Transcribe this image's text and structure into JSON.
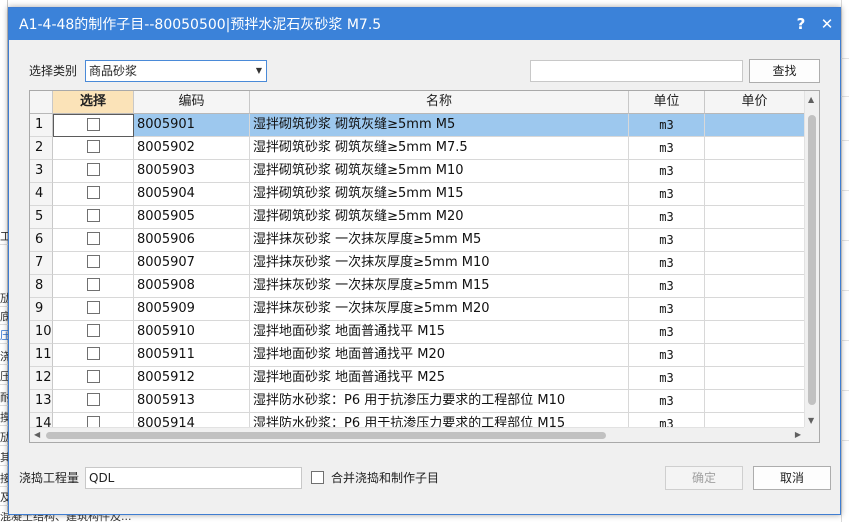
{
  "dialog": {
    "title": "A1-4-48的制作子目--80050500|预拌水泥石灰砂浆 M7.5",
    "help_glyph": "?",
    "close_glyph": "✕"
  },
  "filter": {
    "category_label": "选择类别",
    "category_value": "商品砂浆",
    "search_value": "",
    "search_button": "查找"
  },
  "table": {
    "columns": [
      "选择",
      "编码",
      "名称",
      "单位",
      "单价"
    ],
    "rows": [
      {
        "no": "1",
        "code": "8005901",
        "name": "湿拌砌筑砂浆 砌筑灰缝≥5mm M5",
        "unit": "m3",
        "price": ""
      },
      {
        "no": "2",
        "code": "8005902",
        "name": "湿拌砌筑砂浆 砌筑灰缝≥5mm M7.5",
        "unit": "m3",
        "price": ""
      },
      {
        "no": "3",
        "code": "8005903",
        "name": "湿拌砌筑砂浆 砌筑灰缝≥5mm M10",
        "unit": "m3",
        "price": ""
      },
      {
        "no": "4",
        "code": "8005904",
        "name": "湿拌砌筑砂浆 砌筑灰缝≥5mm M15",
        "unit": "m3",
        "price": ""
      },
      {
        "no": "5",
        "code": "8005905",
        "name": "湿拌砌筑砂浆 砌筑灰缝≥5mm M20",
        "unit": "m3",
        "price": ""
      },
      {
        "no": "6",
        "code": "8005906",
        "name": "湿拌抹灰砂浆 一次抹灰厚度≥5mm M5",
        "unit": "m3",
        "price": ""
      },
      {
        "no": "7",
        "code": "8005907",
        "name": "湿拌抹灰砂浆 一次抹灰厚度≥5mm M10",
        "unit": "m3",
        "price": ""
      },
      {
        "no": "8",
        "code": "8005908",
        "name": "湿拌抹灰砂浆 一次抹灰厚度≥5mm M15",
        "unit": "m3",
        "price": ""
      },
      {
        "no": "9",
        "code": "8005909",
        "name": "湿拌抹灰砂浆 一次抹灰厚度≥5mm M20",
        "unit": "m3",
        "price": ""
      },
      {
        "no": "10",
        "code": "8005910",
        "name": "湿拌地面砂浆 地面普通找平 M15",
        "unit": "m3",
        "price": ""
      },
      {
        "no": "11",
        "code": "8005911",
        "name": "湿拌地面砂浆 地面普通找平 M20",
        "unit": "m3",
        "price": ""
      },
      {
        "no": "12",
        "code": "8005912",
        "name": "湿拌地面砂浆 地面普通找平 M25",
        "unit": "m3",
        "price": ""
      },
      {
        "no": "13",
        "code": "8005913",
        "name": "湿拌防水砂浆：P6 用于抗渗压力要求的工程部位 M10",
        "unit": "m3",
        "price": ""
      },
      {
        "no": "14",
        "code": "8005914",
        "name": "湿拌防水砂浆：P6 用于抗渗压力要求的工程部位 M15",
        "unit": "m3",
        "price": ""
      }
    ]
  },
  "footer": {
    "quantity_label": "浇捣工程量",
    "quantity_value": "QDL",
    "merge_label": "合并浇捣和制作子目",
    "ok_button": "确定",
    "cancel_button": "取消"
  },
  "background": {
    "left_chars": [
      "工",
      "劢",
      "底",
      "压",
      "浇",
      "压",
      "耐",
      "摸",
      "劢",
      "其",
      "接",
      "及"
    ],
    "bottom_text": "混凝土结构、建筑构件及..."
  },
  "colors": {
    "titlebar": "#3b82d9",
    "selected_row": "#9dc8ee",
    "select_header": "#fbe3b8"
  }
}
